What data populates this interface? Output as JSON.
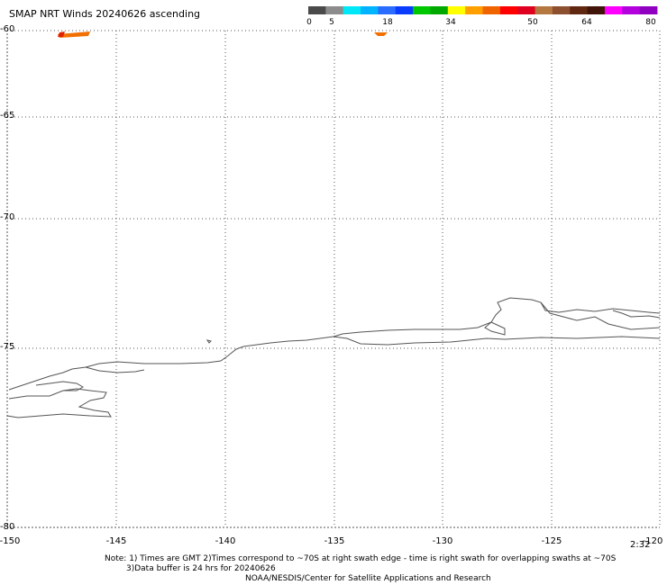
{
  "title": "SMAP NRT Winds 20240626 ascending",
  "colorbar": {
    "labels": [
      "0",
      "5",
      "18",
      "34",
      "50",
      "64",
      "80"
    ],
    "segments": [
      "#4a4a4a",
      "#8c8c8c",
      "#00e8f8",
      "#00b4ff",
      "#2a6cff",
      "#0a3cff",
      "#00c800",
      "#00a800",
      "#ffff00",
      "#ffa000",
      "#f06400",
      "#ff0000",
      "#e00020",
      "#b47840",
      "#8c5030",
      "#602810",
      "#401408",
      "#ff00ff",
      "#b400dc",
      "#9000c0"
    ]
  },
  "lat_labels": [
    "-60",
    "-65",
    "-70",
    "-75",
    "-80"
  ],
  "lon_labels": [
    "-150",
    "-145",
    "-140",
    "-135",
    "-130",
    "-125",
    "-120"
  ],
  "time_label": "2:32",
  "notes": {
    "line1": "Note: 1) Times are GMT 2)Times correspond to ~70S at right swath edge - time is right swath for overlapping swaths at ~70S",
    "line2": "3)Data buffer is 24 hrs for 20240626",
    "line3": "NOAA/NESDIS/Center for Satellite Applications and Research"
  },
  "colors": {
    "coastline": "#555555",
    "grid": "#555555",
    "wind_swath": "#f07000"
  }
}
